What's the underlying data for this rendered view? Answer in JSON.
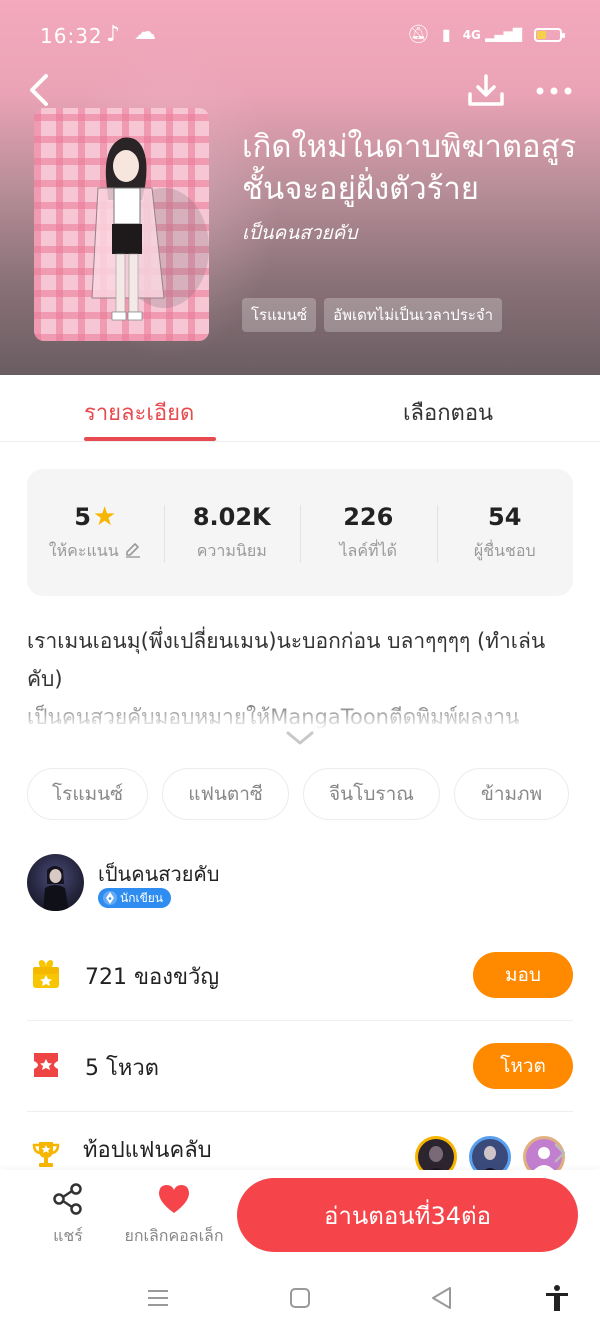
{
  "status_bar": {
    "time": "16:32",
    "signal_text": "4G",
    "icons": [
      "tiktok-icon",
      "cloud-icon",
      "bell-off-icon",
      "vibrate-icon",
      "signal-icon",
      "battery-icon"
    ]
  },
  "header": {
    "title": "เกิดใหม่ในดาบพิฆาตอสูรชั้นจะอยู่ฝั่งตัวร้าย",
    "author_line": "เป็นคนสวยคับ",
    "tags": [
      "โรแมนซ์",
      "อัพเดทไม่เป็นเวลาประจำ"
    ]
  },
  "tabs": [
    {
      "label": "รายละเอียด",
      "active": true
    },
    {
      "label": "เลือกตอน",
      "active": false
    }
  ],
  "stats": [
    {
      "value": "5",
      "label": "ให้คะแนน"
    },
    {
      "value": "8.02K",
      "label": "ความนิยม"
    },
    {
      "value": "226",
      "label": "ไลค์ที่ได้"
    },
    {
      "value": "54",
      "label": "ผู้ชื่นชอบ"
    }
  ],
  "description": {
    "line1": "เราเมนเอนมุ(พึ่งเปลี่ยนเมน)นะบอกก่อน บลาๆๆๆๆ (ทำเล่นคับ)",
    "line2": "เป็นคนสวยคับมอบหมายให้MangaToonตีดพิมพ์ผลงาน"
  },
  "genres": [
    "โรแมนซ์",
    "แฟนตาซี",
    "จีนโบราณ",
    "ข้ามภพ"
  ],
  "author": {
    "name": "เป็นคนสวยคับ",
    "badge": "นักเขียน"
  },
  "gifts": {
    "count": "721",
    "label": "ของขวัญ",
    "button": "มอบ"
  },
  "votes": {
    "count": "5",
    "label": "โหวต",
    "button": "โหวต"
  },
  "fanclub": {
    "label": "ท้อปแฟนคลับ"
  },
  "bottom_bar": {
    "share_label": "แชร์",
    "unfav_label": "ยกเลิกคอลเล็ก",
    "read_label": "อ่านตอนที่34ต่อ"
  },
  "colors": {
    "accent": "#e84b4f",
    "read_button": "#f5454a",
    "orange_button": "#ff8a00",
    "star": "#f7b500"
  }
}
